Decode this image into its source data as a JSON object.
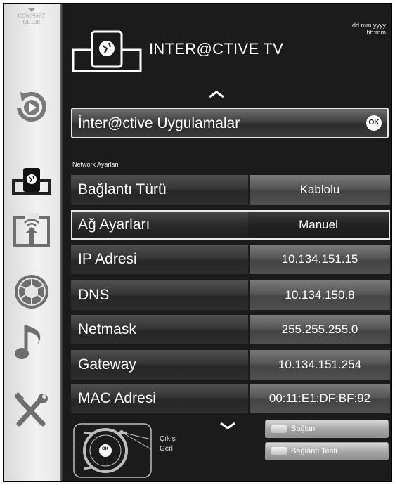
{
  "sidebar": {
    "logo_line1": "COMFORT",
    "logo_line2": "GUIDE",
    "icons": [
      "playback-icon",
      "interactive-tv-icon",
      "media-sharing-icon",
      "camera-aperture-icon",
      "music-note-icon",
      "tools-icon"
    ]
  },
  "header": {
    "title": "INTER@CTIVE TV",
    "date": "dd.mm.yyyy",
    "time": "hh:mm"
  },
  "apps_bar": {
    "label": "İnter@ctive Uygulamalar",
    "ok_badge": "OK"
  },
  "section_title": "Network Ayarları",
  "rows": [
    {
      "label": "Bağlantı Türü",
      "value": "Kablolu"
    },
    {
      "label": "Ağ Ayarları",
      "value": "Manuel"
    },
    {
      "label": "IP Adresi",
      "value": "10.134.151.15"
    },
    {
      "label": "DNS",
      "value": "10.134.150.8"
    },
    {
      "label": "Netmask",
      "value": "255.255.255.0"
    },
    {
      "label": "Gateway",
      "value": "10.134.151.254"
    },
    {
      "label": "MAC Adresi",
      "value": "00:11:E1:DF:BF:92"
    }
  ],
  "footer": {
    "ok_label": "OK",
    "exit_label": "Çıkış",
    "back_label": "Geri",
    "connect_label": "Bağlan",
    "connection_test_label": "Bağlantı Testi"
  },
  "colors": {
    "panel_bg": "#1b1b1b",
    "sidebar_bg": "#e6e6e6",
    "text": "#ffffff",
    "selected_border": "#e8e8e8"
  }
}
